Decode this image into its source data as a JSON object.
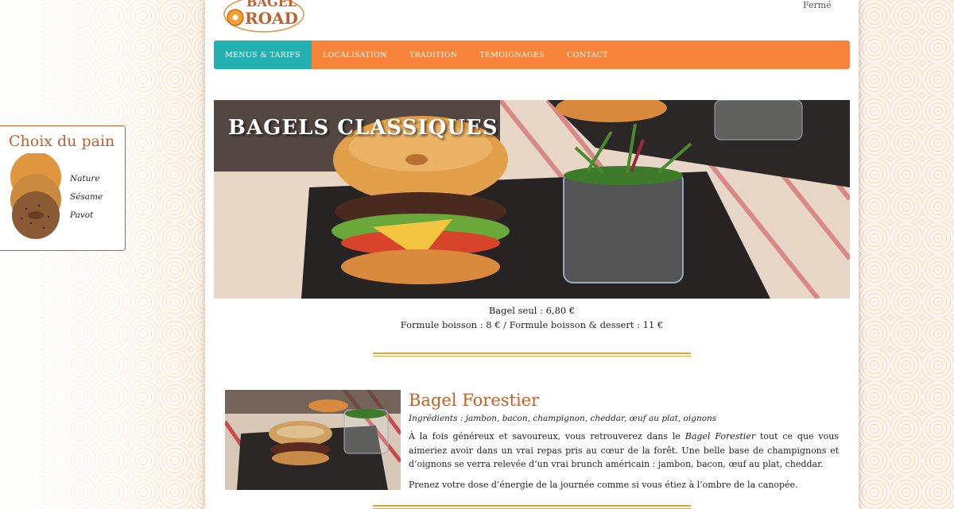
{
  "brand": {
    "logo_top": "BAGEL",
    "logo_bottom": "ROAD"
  },
  "status": "Fermé",
  "nav": {
    "items": [
      {
        "label": "MENUS & TARIFS",
        "active": true
      },
      {
        "label": "LOCALISATION"
      },
      {
        "label": "TRADITION"
      },
      {
        "label": "TÉMOIGNAGES"
      },
      {
        "label": "CONTACT"
      }
    ]
  },
  "hero": {
    "title": "BAGELS CLASSIQUES"
  },
  "pricing": {
    "line1": "Bagel seul : 6,80 €",
    "line2": "Formule boisson : 8 € / Formule boisson & dessert : 11 €"
  },
  "item": {
    "title": "Bagel Forestier",
    "ingredients": "Ingrédients : jambon, bacon, champignon, cheddar, œuf au plat, oignons",
    "desc_before": "À la fois généreux et savoureux, vous retrouverez dans le ",
    "desc_em": "Bagel Forestier",
    "desc_after": " tout ce que vous aimeriez avoir dans un vrai repas pris au cœur de la forêt. Une belle base de champignons et d’oignons se verra relevée d’un vrai brunch américain : jambon, bacon, œuf au plat, cheddar.",
    "desc2": "Prenez votre dose d’énergie de la journée comme si vous étiez à l’ombre de la canopée."
  },
  "sidebar": {
    "title": "Choix du pain",
    "breads": [
      "Nature",
      "Sésame",
      "Pavot"
    ]
  },
  "colors": {
    "accent": "#f7843a",
    "active": "#22b0b0",
    "title": "#c0602a",
    "gold": "#d8a53e"
  }
}
